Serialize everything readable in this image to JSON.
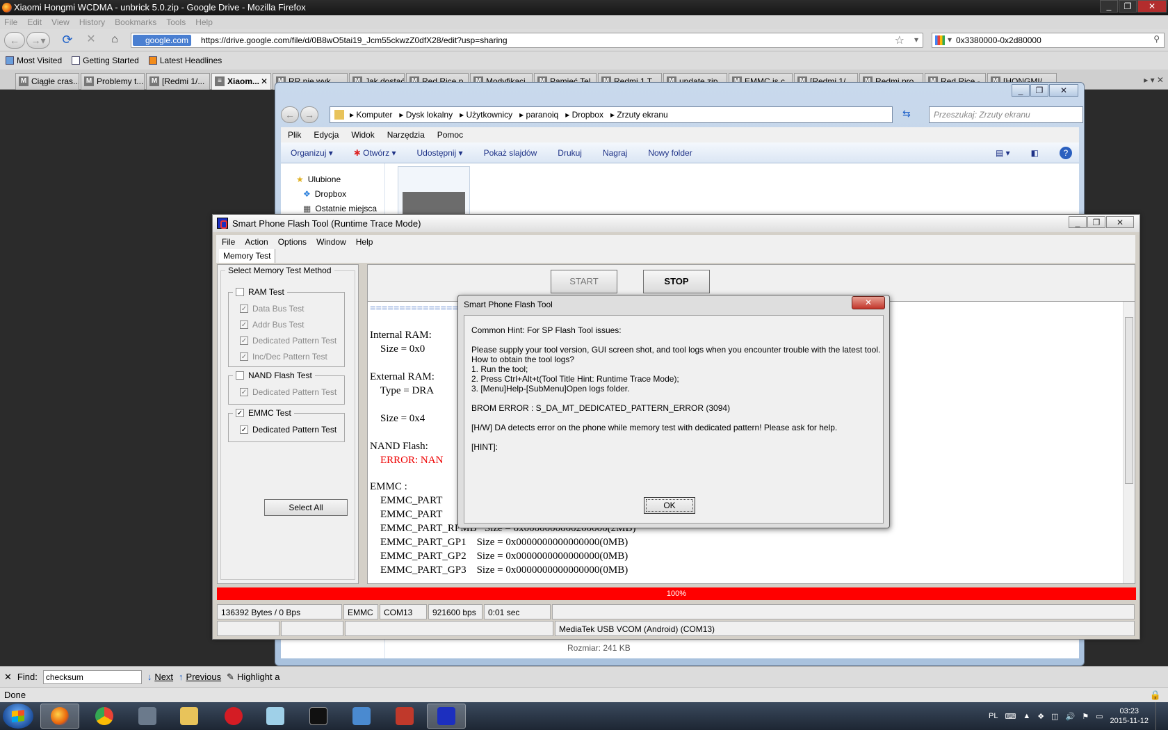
{
  "firefox": {
    "title": "Xiaomi Hongmi WCDMA - unbrick 5.0.zip - Google Drive - Mozilla Firefox",
    "menu": [
      "File",
      "Edit",
      "View",
      "History",
      "Bookmarks",
      "Tools",
      "Help"
    ],
    "site_badge": "google.com",
    "url": "https://drive.google.com/file/d/0B8wO5tai19_Jcm55ckwzZ0dfX28/edit?usp=sharing",
    "search_value": "0x3380000-0x2d80000",
    "bookmarks": [
      "Most Visited",
      "Getting Started",
      "Latest Headlines"
    ],
    "tabs": [
      "Ciągłe cras...",
      "Problemy t...",
      "[Redmi 1/...",
      "Xiaom...",
      "RR nie wyk...",
      "Jak dostać...",
      "Red Rice p...",
      "Modyfikacj...",
      "Pamięć Tel...",
      "Redmi 1 T...",
      "update.zip...",
      "EMMC is c...",
      "[Redmi 1/...",
      "Redmi pro...",
      "Red Rice - ...",
      "[HONGMI/..."
    ]
  },
  "explorer": {
    "path": [
      "Komputer",
      "Dysk lokalny",
      "Użytkownicy",
      "paranoiq",
      "Dropbox",
      "Zrzuty ekranu"
    ],
    "search_placeholder": "Przeszukaj: Zrzuty ekranu",
    "menu": [
      "Plik",
      "Edycja",
      "Widok",
      "Narzędzia",
      "Pomoc"
    ],
    "toolbar": [
      "Organizuj",
      "Otwórz",
      "Udostępnij",
      "Pokaż slajdów",
      "Drukuj",
      "Nagraj",
      "Nowy folder"
    ],
    "nav": [
      "Ulubione",
      "Dropbox",
      "Ostatnie miejsca"
    ],
    "size_label": "Rozmiar: 241 KB"
  },
  "sp": {
    "title": "Smart Phone Flash Tool (Runtime Trace Mode)",
    "menu": [
      "File",
      "Action",
      "Options",
      "Window",
      "Help"
    ],
    "tab": "Memory Test",
    "group_title": "Select Memory Test Method",
    "ram_test": "RAM Test",
    "ram_opts": [
      "Data Bus Test",
      "Addr Bus Test",
      "Dedicated Pattern Test",
      "Inc/Dec Pattern Test"
    ],
    "nand_test": "NAND Flash Test",
    "nand_opt": "Dedicated Pattern Test",
    "emmc_test": "EMMC Test",
    "emmc_opt": "Dedicated Pattern Test",
    "select_all": "Select All",
    "start": "START",
    "stop": "STOP",
    "log": {
      "sep": "===============",
      "l1": "Internal RAM:",
      "l2": "    Size = 0x0",
      "l3": "External RAM:",
      "l4": "    Type = DRA",
      "l5": "    Size = 0x4",
      "l6": "NAND Flash:",
      "l7": "    ERROR: NAN",
      "l8": "EMMC :",
      "l9": "    EMMC_PART",
      "l10": "    EMMC_PART",
      "l11": "    EMMC_PART_RPMB   Size = 0x0000000000200000(2MB)",
      "l12": "    EMMC_PART_GP1    Size = 0x0000000000000000(0MB)",
      "l13": "    EMMC_PART_GP2    Size = 0x0000000000000000(0MB)",
      "l14": "    EMMC_PART_GP3    Size = 0x0000000000000000(0MB)"
    },
    "progress": "100%",
    "status": {
      "bytes": "136392 Bytes / 0 Bps",
      "type": "EMMC",
      "port": "COM13",
      "baud": "921600 bps",
      "time": "0:01 sec",
      "device": "MediaTek USB VCOM (Android) (COM13)"
    }
  },
  "dialog": {
    "title": "Smart Phone Flash Tool",
    "hint": "Common Hint: For SP Flash Tool issues:",
    "p1": "Please supply your tool version, GUI screen shot, and tool logs when you encounter trouble with the latest tool.",
    "p2": "How to obtain the tool logs?",
    "s1": "1. Run the tool;",
    "s2": "2. Press Ctrl+Alt+t(Tool Title Hint: Runtime Trace Mode);",
    "s3": "3. [Menu]Help-[SubMenu]Open logs folder.",
    "brom": "BROM ERROR : S_DA_MT_DEDICATED_PATTERN_ERROR (3094)",
    "hw": "[H/W] DA detects error on the phone while memory test with dedicated pattern! Please ask for help.",
    "hint2": "[HINT]:",
    "ok": "OK"
  },
  "findbar": {
    "label": "Find:",
    "value": "checksum",
    "next": "Next",
    "previous": "Previous",
    "highlight": "Highlight a"
  },
  "status": "Done",
  "tray": {
    "lang": "PL",
    "time": "03:23",
    "date": "2015-11-12"
  }
}
